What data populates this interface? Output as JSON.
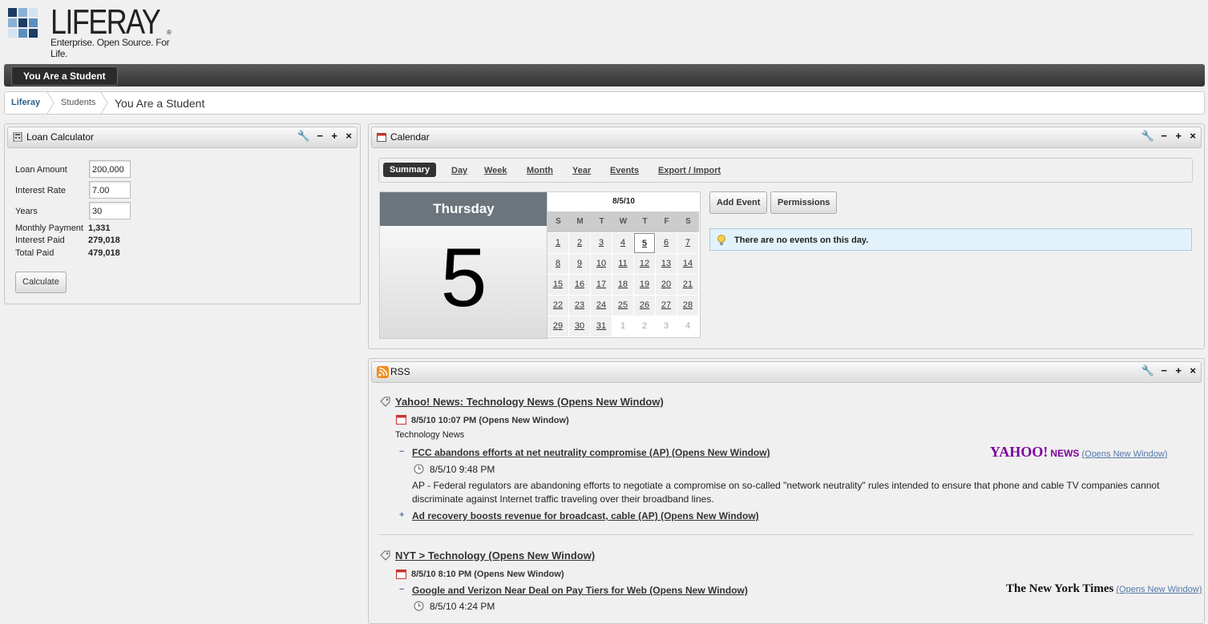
{
  "logo": {
    "word": "LIFERAY",
    "tagline": "Enterprise. Open Source. For Life.",
    "reg": "®"
  },
  "nav": {
    "tab": "You Are a Student"
  },
  "breadcrumb": {
    "items": [
      "Liferay",
      "Students",
      "You Are a Student"
    ]
  },
  "loan": {
    "title": "Loan Calculator",
    "amount_label": "Loan Amount",
    "amount": "200,000",
    "rate_label": "Interest Rate",
    "rate": "7.00",
    "years_label": "Years",
    "years": "30",
    "monthly_label": "Monthly Payment",
    "monthly": "1,331",
    "interest_label": "Interest Paid",
    "interest": "279,018",
    "total_label": "Total Paid",
    "total": "479,018",
    "calc": "Calculate"
  },
  "calendar": {
    "title": "Calendar",
    "tabs": [
      "Summary",
      "Day",
      "Week",
      "Month",
      "Year",
      "Events",
      "Export / Import"
    ],
    "weekday": "Thursday",
    "day": "5",
    "month_header": "8/5/10",
    "dow": [
      "S",
      "M",
      "T",
      "W",
      "T",
      "F",
      "S"
    ],
    "days": [
      "1",
      "2",
      "3",
      "4",
      "5",
      "6",
      "7",
      "8",
      "9",
      "10",
      "11",
      "12",
      "13",
      "14",
      "15",
      "16",
      "17",
      "18",
      "19",
      "20",
      "21",
      "22",
      "23",
      "24",
      "25",
      "26",
      "27",
      "28",
      "29",
      "30",
      "31",
      "1",
      "2",
      "3",
      "4"
    ],
    "add_event": "Add Event",
    "permissions": "Permissions",
    "no_events": "There are no events on this day."
  },
  "rss": {
    "title": "RSS",
    "feed1": {
      "title": "Yahoo! News: Technology News (Opens New Window)",
      "date": "8/5/10 10:07 PM (Opens New Window)",
      "desc": "Technology News",
      "item1": "FCC abandons efforts at net neutrality compromise (AP) (Opens New Window)",
      "item1_date": "8/5/10 9:48 PM",
      "item1_body": "AP - Federal regulators are abandoning efforts to negotiate a compromise on so-called \"network neutrality\" rules intended to ensure that phone and cable TV companies cannot discriminate against Internet traffic traveling over their broadband lines.",
      "item2": "Ad recovery boosts revenue for broadcast, cable (AP) (Opens New Window)",
      "logo": "YAHOO!",
      "logo_news": "NEWS",
      "logo_link": "(Opens New Window)"
    },
    "feed2": {
      "title": "NYT > Technology (Opens New Window)",
      "date": "8/5/10 8:10 PM (Opens New Window)",
      "item1": "Google and Verizon Near Deal on Pay Tiers for Web (Opens New Window)",
      "item1_date": "8/5/10 4:24 PM",
      "logo": "The New York Times",
      "logo_link": "(Opens New Window)"
    }
  },
  "controls": {
    "wrench": "🔧",
    "min": "−",
    "max": "+",
    "close": "×"
  }
}
